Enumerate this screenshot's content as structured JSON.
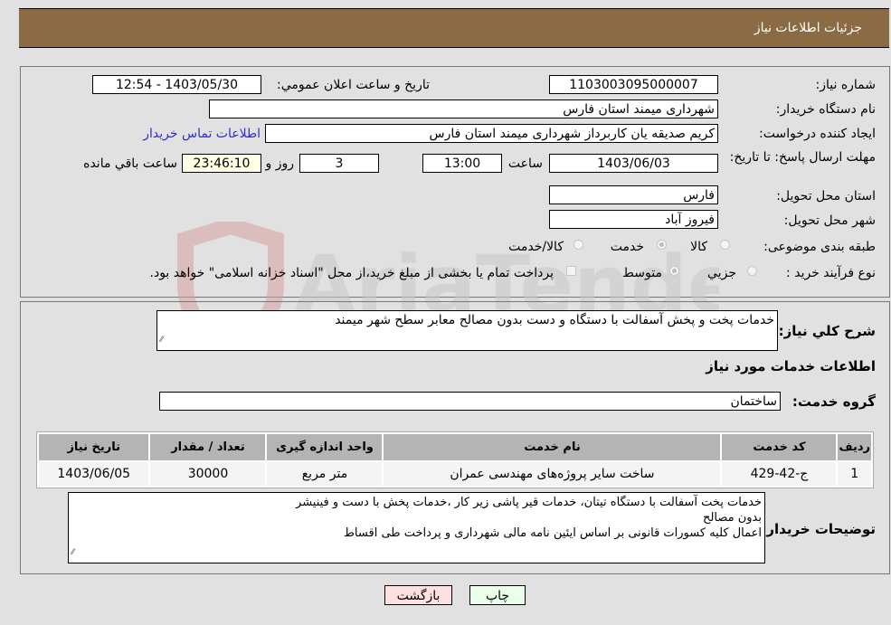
{
  "header": {
    "title": "جزئیات اطلاعات نیاز"
  },
  "form": {
    "need_number_label": "شماره نیاز:",
    "need_number": "1103003095000007",
    "announce_label": "تاریخ و ساعت اعلان عمومي:",
    "announce_value": "1403/05/30 - 12:54",
    "buyer_org_label": "نام دستگاه خریدار:",
    "buyer_org": "شهرداری میمند استان فارس",
    "creator_label": "ایجاد کننده درخواست:",
    "creator": "کریم  صدیقه یان  کاربرداز شهرداری میمند استان فارس",
    "contact_link": "اطلاعات تماس خریدار",
    "deadline_label": "مهلت ارسال پاسخ: تا تاریخ:",
    "deadline_date": "1403/06/03",
    "time_label": "ساعت",
    "deadline_time": "13:00",
    "days": "3",
    "days_label": "روز و",
    "remaining": "23:46:10",
    "remaining_label": "ساعت باقي مانده",
    "province_label": "استان محل تحویل:",
    "province": "فارس",
    "city_label": "شهر محل تحویل:",
    "city": "فیروز آباد",
    "category_label": "طبقه بندی موضوعی:",
    "category_options": [
      "کالا",
      "خدمت",
      "کالا/خدمت"
    ],
    "category_selected": "خدمت",
    "process_label": "نوع فرآیند خرید :",
    "process_options": [
      "جزيي",
      "متوسط"
    ],
    "process_selected": "متوسط",
    "treasury_note": "پرداخت تمام یا بخشی از مبلغ خرید،از محل \"اسناد خزانه اسلامی\" خواهد بود."
  },
  "summary": {
    "label": "شرح کلي نیاز:",
    "value": "خدمات پخت و پخش آسفالت با دستگاه و دست بدون مصالح معابر سطح شهر میمند"
  },
  "services": {
    "section_title": "اطلاعات خدمات مورد نیاز",
    "group_label": "گروه خدمت:",
    "group_value": "ساختمان",
    "columns": [
      "ردیف",
      "کد خدمت",
      "نام خدمت",
      "واحد اندازه گیری",
      "تعداد / مقدار",
      "تاریخ نیاز"
    ],
    "rows": [
      [
        "1",
        "ج-42-429",
        "ساخت سایر پروژه‌های مهندسی عمران",
        "متر مربع",
        "30000",
        "1403/06/05"
      ]
    ]
  },
  "buyer_notes": {
    "label": "توضیحات خریدار:",
    "lines": [
      "خدمات پخت آسفالت با دستگاه تیتان، خدمات قیر پاشی زیر کار ،خدمات پخش با دست و فینیشر",
      "بدون مصالح",
      "اعمال کلیه کسورات قانونی بر اساس ایئین نامه مالی شهرداری و پرداخت  طی اقساط"
    ]
  },
  "buttons": {
    "print": "چاپ",
    "back": "بازگشت"
  },
  "watermark": {
    "text": "AriaTender.neT"
  },
  "colors": {
    "header_bg": "#8b6b43",
    "print_bg": "#eaffea",
    "back_bg": "#ffe0e0",
    "remaining_bg": "#ffffe6",
    "link": "#2d2dcc"
  }
}
